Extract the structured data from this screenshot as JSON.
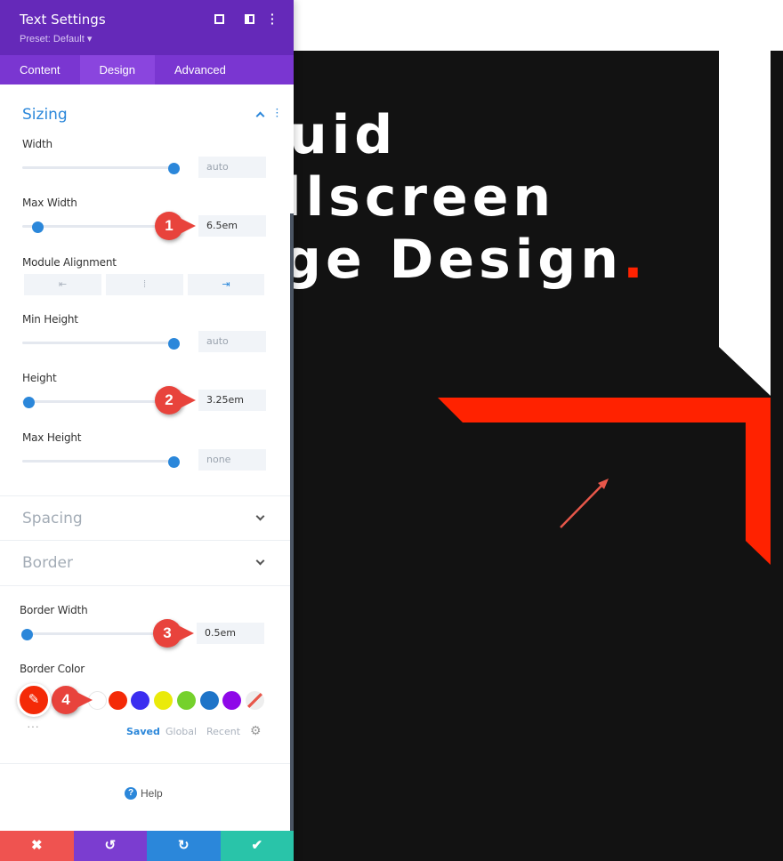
{
  "panel": {
    "title": "Text Settings",
    "preset": "Preset: Default ▾",
    "tabs": [
      {
        "label": "Content"
      },
      {
        "label": "Design",
        "active": true
      },
      {
        "label": "Advanced"
      }
    ],
    "sizing": {
      "title": "Sizing",
      "width": {
        "label": "Width",
        "value": "auto",
        "slider_level": 1.0
      },
      "max_width": {
        "label": "Max Width",
        "value": "6.5em",
        "slider_level": 0.06
      },
      "module_alignment": {
        "label": "Module Alignment",
        "options": [
          "left",
          "center",
          "right"
        ],
        "selected": "right"
      },
      "min_height": {
        "label": "Min Height",
        "value": "auto",
        "slider_level": 1.0
      },
      "height": {
        "label": "Height",
        "value": "3.25em",
        "slider_level": 0.0
      },
      "max_height": {
        "label": "Max Height",
        "value": "none",
        "slider_level": 1.0
      }
    },
    "spacing": {
      "title": "Spacing"
    },
    "border": {
      "title": "Border",
      "border_width": {
        "label": "Border Width",
        "value": "0.5em",
        "slider_level": 0.0
      },
      "border_color": {
        "label": "Border Color",
        "selected": "#f42a07",
        "swatches": [
          "#ffffff",
          "#f42a07",
          "#3b2ef0",
          "#eaea0a",
          "#75d12c",
          "#1e74c8",
          "#8e08e8",
          "none"
        ],
        "tabs": [
          "Saved",
          "Global",
          "Recent"
        ],
        "active_tab": "Saved"
      }
    },
    "help": "Help",
    "footer": {
      "cancel": "✖",
      "undo": "↺",
      "redo": "↻",
      "save": "✔"
    },
    "callouts": [
      "1",
      "2",
      "3",
      "4"
    ]
  },
  "canvas": {
    "heading_lines": [
      "uid",
      "llscreen",
      "ge Design"
    ],
    "heading_dot": ".",
    "accent": "#ff2200"
  }
}
